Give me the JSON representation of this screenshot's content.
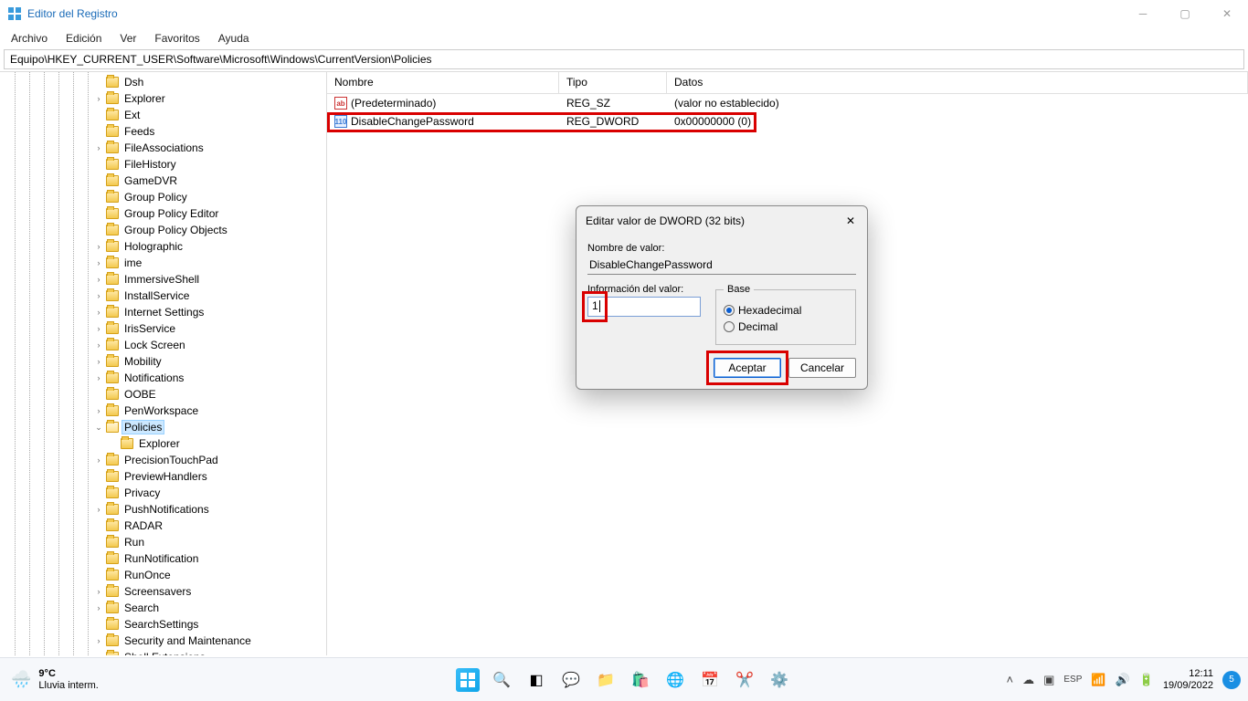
{
  "window": {
    "title": "Editor del Registro"
  },
  "menu": {
    "items": [
      "Archivo",
      "Edición",
      "Ver",
      "Favoritos",
      "Ayuda"
    ]
  },
  "path": "Equipo\\HKEY_CURRENT_USER\\Software\\Microsoft\\Windows\\CurrentVersion\\Policies",
  "tree": [
    {
      "label": "Dsh",
      "indent": 6,
      "chev": ""
    },
    {
      "label": "Explorer",
      "indent": 6,
      "chev": ">"
    },
    {
      "label": "Ext",
      "indent": 6,
      "chev": ""
    },
    {
      "label": "Feeds",
      "indent": 6,
      "chev": ""
    },
    {
      "label": "FileAssociations",
      "indent": 6,
      "chev": ">"
    },
    {
      "label": "FileHistory",
      "indent": 6,
      "chev": ""
    },
    {
      "label": "GameDVR",
      "indent": 6,
      "chev": ""
    },
    {
      "label": "Group Policy",
      "indent": 6,
      "chev": ""
    },
    {
      "label": "Group Policy Editor",
      "indent": 6,
      "chev": ""
    },
    {
      "label": "Group Policy Objects",
      "indent": 6,
      "chev": ""
    },
    {
      "label": "Holographic",
      "indent": 6,
      "chev": ">"
    },
    {
      "label": "ime",
      "indent": 6,
      "chev": ">"
    },
    {
      "label": "ImmersiveShell",
      "indent": 6,
      "chev": ">"
    },
    {
      "label": "InstallService",
      "indent": 6,
      "chev": ">"
    },
    {
      "label": "Internet Settings",
      "indent": 6,
      "chev": ">"
    },
    {
      "label": "IrisService",
      "indent": 6,
      "chev": ">"
    },
    {
      "label": "Lock Screen",
      "indent": 6,
      "chev": ">"
    },
    {
      "label": "Mobility",
      "indent": 6,
      "chev": ">"
    },
    {
      "label": "Notifications",
      "indent": 6,
      "chev": ">"
    },
    {
      "label": "OOBE",
      "indent": 6,
      "chev": ""
    },
    {
      "label": "PenWorkspace",
      "indent": 6,
      "chev": ">"
    },
    {
      "label": "Policies",
      "indent": 6,
      "chev": "v",
      "selected": true,
      "open": true
    },
    {
      "label": "Explorer",
      "indent": 7,
      "chev": ""
    },
    {
      "label": "PrecisionTouchPad",
      "indent": 6,
      "chev": ">"
    },
    {
      "label": "PreviewHandlers",
      "indent": 6,
      "chev": ""
    },
    {
      "label": "Privacy",
      "indent": 6,
      "chev": ""
    },
    {
      "label": "PushNotifications",
      "indent": 6,
      "chev": ">"
    },
    {
      "label": "RADAR",
      "indent": 6,
      "chev": ""
    },
    {
      "label": "Run",
      "indent": 6,
      "chev": ""
    },
    {
      "label": "RunNotification",
      "indent": 6,
      "chev": ""
    },
    {
      "label": "RunOnce",
      "indent": 6,
      "chev": ""
    },
    {
      "label": "Screensavers",
      "indent": 6,
      "chev": ">"
    },
    {
      "label": "Search",
      "indent": 6,
      "chev": ">"
    },
    {
      "label": "SearchSettings",
      "indent": 6,
      "chev": ""
    },
    {
      "label": "Security and Maintenance",
      "indent": 6,
      "chev": ">"
    },
    {
      "label": "Shell Extensions",
      "indent": 6,
      "chev": ">"
    }
  ],
  "list": {
    "columns": {
      "name": "Nombre",
      "type": "Tipo",
      "data": "Datos"
    },
    "rows": [
      {
        "icon": "sz",
        "name": "(Predeterminado)",
        "type": "REG_SZ",
        "data": "(valor no establecido)"
      },
      {
        "icon": "dw",
        "name": "DisableChangePassword",
        "type": "REG_DWORD",
        "data": "0x00000000 (0)",
        "highlight": true
      }
    ]
  },
  "dialog": {
    "title": "Editar valor de DWORD (32 bits)",
    "name_label": "Nombre de valor:",
    "name_value": "DisableChangePassword",
    "data_label": "Información del valor:",
    "data_value": "1",
    "base_label": "Base",
    "radio_hex": "Hexadecimal",
    "radio_dec": "Decimal",
    "ok": "Aceptar",
    "cancel": "Cancelar"
  },
  "taskbar": {
    "temp": "9°C",
    "weather": "Lluvia interm.",
    "time": "12:11",
    "date": "19/09/2022",
    "notif": "5"
  }
}
